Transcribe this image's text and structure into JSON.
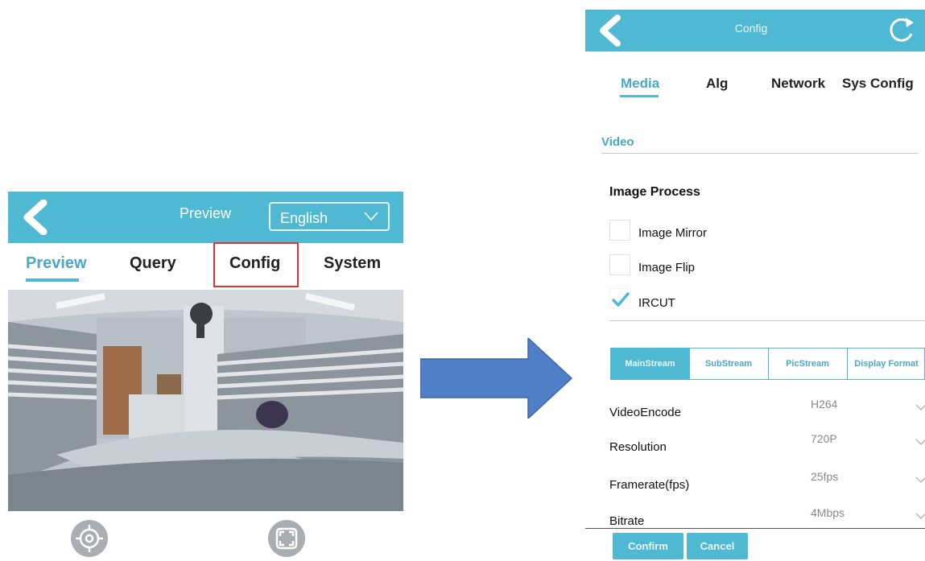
{
  "preview_screen": {
    "header": {
      "title": "Preview",
      "language_value": "English"
    },
    "tabs": [
      {
        "label": "Preview",
        "active": true
      },
      {
        "label": "Query",
        "active": false
      },
      {
        "label": "Config",
        "active": false,
        "highlighted": true
      },
      {
        "label": "System",
        "active": false
      }
    ],
    "controls": [
      {
        "icon": "crosshair-icon"
      },
      {
        "icon": "fullscreen-icon"
      }
    ]
  },
  "config_screen": {
    "header": {
      "title": "Config"
    },
    "tabs": [
      {
        "label": "Media",
        "active": true
      },
      {
        "label": "Alg",
        "active": false
      },
      {
        "label": "Network",
        "active": false
      },
      {
        "label": "Sys Config",
        "active": false
      }
    ],
    "section_video": "Video",
    "image_process": {
      "title": "Image Process",
      "options": [
        {
          "label": "Image Mirror",
          "checked": false
        },
        {
          "label": "Image Flip",
          "checked": false
        },
        {
          "label": "IRCUT",
          "checked": true
        }
      ]
    },
    "stream_tabs": [
      {
        "label": "MainStream",
        "active": true
      },
      {
        "label": "SubStream",
        "active": false
      },
      {
        "label": "PicStream",
        "active": false
      },
      {
        "label": "Display Format",
        "active": false
      }
    ],
    "settings": [
      {
        "label": "VideoEncode",
        "value": "H264"
      },
      {
        "label": "Resolution",
        "value": "720P"
      },
      {
        "label": "Framerate(fps)",
        "value": "25fps"
      },
      {
        "label": "Bitrate",
        "value": "4Mbps"
      }
    ],
    "buttons": {
      "confirm": "Confirm",
      "cancel": "Cancel"
    }
  },
  "colors": {
    "accent": "#4fb8d3",
    "active_tab_text": "#4aa8c6",
    "highlight_box": "#e43333",
    "arrow_fill": "#4f7fc6"
  }
}
